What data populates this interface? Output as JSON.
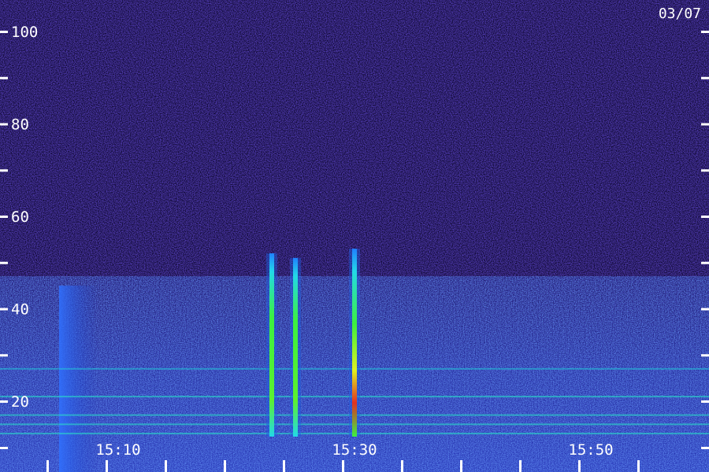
{
  "date_label": "03/07",
  "colors": {
    "background": "#0a0428",
    "noise_low": "#1a1070",
    "noise_mid": "#2a3ec8",
    "cyan": "#22e0e0",
    "green": "#3cf040",
    "yellow": "#e0f020",
    "red": "#e03020",
    "axis_text": "#ffffff"
  },
  "chart_data": {
    "type": "heatmap",
    "title": "",
    "xlabel": "",
    "ylabel": "",
    "y_ticks": [
      "20",
      "40",
      "60",
      "80",
      "100"
    ],
    "x_ticks": [
      "15:10",
      "15:30",
      "15:50"
    ],
    "ylim": [
      10,
      105
    ],
    "xlim": [
      "15:05",
      "15:55"
    ],
    "grid": false,
    "events": [
      {
        "time": "15:23",
        "fmax": 52,
        "peak_color": "green"
      },
      {
        "time": "15:25",
        "fmax": 51,
        "peak_color": "green"
      },
      {
        "time": "15:30",
        "fmax": 53,
        "peak_color": "red"
      }
    ],
    "early_emission": {
      "start": "15:05",
      "end": "15:07",
      "fmax": 45
    },
    "noise_band_fmax": 47,
    "hum_lines": [
      27,
      21,
      17,
      15,
      13
    ]
  }
}
